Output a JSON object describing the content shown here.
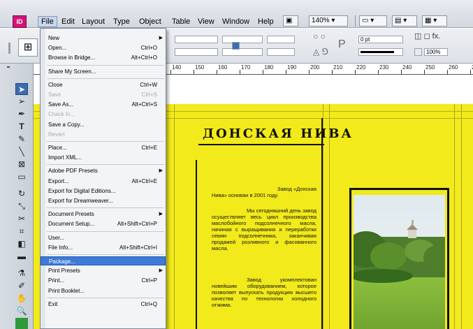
{
  "menubar": {
    "app_icon": "ID",
    "items": [
      "File",
      "Edit",
      "Layout",
      "Type",
      "Object",
      "Table",
      "View",
      "Window",
      "Help"
    ],
    "zoom": "140%"
  },
  "control_bar": {
    "stroke_weight": "0 pt",
    "opacity": "100%",
    "text_label": "P"
  },
  "ruler": {
    "numbers": [
      "140",
      "150",
      "160",
      "170",
      "180",
      "190",
      "200",
      "210",
      "220",
      "230",
      "240",
      "250",
      "260",
      "270"
    ]
  },
  "document": {
    "title": "ДОНСКАЯ НИВА",
    "para1_line1": "Завод «Донская",
    "para1_line2": "Нива» основан в 2001 году.",
    "para2": "Мы сегодняшний день завод осуществляет весь цикл производства маслобойного подсолнечного масла, начиная с выращивания и переработки семян подсолнечника, заканчивая продажей розливного и фасованного масла.",
    "para3": "Завод укомплектован новейшим оборудованием, которое позволяет выпускать продукцию высшего качества по технологии холодного отжима."
  },
  "file_menu": {
    "items": [
      {
        "label": "New",
        "shortcut": "",
        "submenu": true,
        "disabled": false
      },
      {
        "label": "Open...",
        "shortcut": "Ctrl+O",
        "submenu": false,
        "disabled": false
      },
      {
        "label": "Browse in Bridge...",
        "shortcut": "Alt+Ctrl+O",
        "submenu": false,
        "disabled": false
      },
      {
        "label": "Share My Screen...",
        "shortcut": "",
        "submenu": false,
        "disabled": false
      },
      {
        "label": "Close",
        "shortcut": "Ctrl+W",
        "submenu": false,
        "disabled": false
      },
      {
        "label": "Save",
        "shortcut": "Ctrl+S",
        "submenu": false,
        "disabled": true
      },
      {
        "label": "Save As...",
        "shortcut": "Alt+Ctrl+S",
        "submenu": false,
        "disabled": false
      },
      {
        "label": "Check In...",
        "shortcut": "",
        "submenu": false,
        "disabled": true
      },
      {
        "label": "Save a Copy...",
        "shortcut": "",
        "submenu": false,
        "disabled": false
      },
      {
        "label": "Revert",
        "shortcut": "",
        "submenu": false,
        "disabled": true
      },
      {
        "label": "Place...",
        "shortcut": "Ctrl+E",
        "submenu": false,
        "disabled": false
      },
      {
        "label": "Import XML...",
        "shortcut": "",
        "submenu": false,
        "disabled": false
      },
      {
        "label": "Adobe PDF Presets",
        "shortcut": "",
        "submenu": true,
        "disabled": false
      },
      {
        "label": "Export...",
        "shortcut": "Alt+Ctrl+E",
        "submenu": false,
        "disabled": false
      },
      {
        "label": "Export for Digital Editions...",
        "shortcut": "",
        "submenu": false,
        "disabled": false
      },
      {
        "label": "Export for Dreamweaver...",
        "shortcut": "",
        "submenu": false,
        "disabled": false
      },
      {
        "label": "Document Presets",
        "shortcut": "",
        "submenu": true,
        "disabled": false
      },
      {
        "label": "Document Setup...",
        "shortcut": "Alt+Shift+Ctrl+P",
        "submenu": false,
        "disabled": false
      },
      {
        "label": "User...",
        "shortcut": "",
        "submenu": false,
        "disabled": false
      },
      {
        "label": "File Info...",
        "shortcut": "Alt+Shift+Ctrl+I",
        "submenu": false,
        "disabled": false
      },
      {
        "label": "Package...",
        "shortcut": "",
        "submenu": false,
        "disabled": false,
        "highlighted": true
      },
      {
        "label": "Print Presets",
        "shortcut": "",
        "submenu": true,
        "disabled": false
      },
      {
        "label": "Print...",
        "shortcut": "Ctrl+P",
        "submenu": false,
        "disabled": false
      },
      {
        "label": "Print Booklet...",
        "shortcut": "",
        "submenu": false,
        "disabled": false
      },
      {
        "label": "Exit",
        "shortcut": "Ctrl+Q",
        "submenu": false,
        "disabled": false
      }
    ]
  },
  "colors": {
    "page": "#f2ea1a",
    "highlight": "#3d7bd6",
    "app_icon": "#d4137a"
  }
}
